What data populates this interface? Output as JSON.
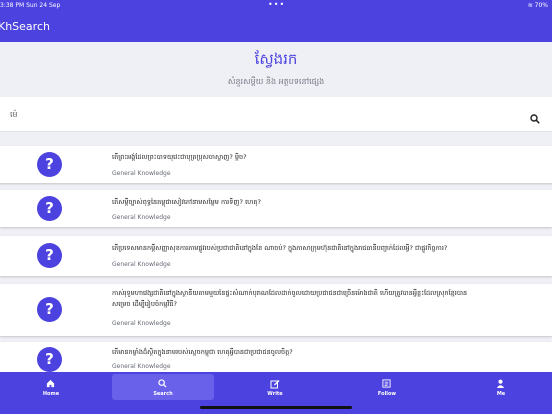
{
  "status_bar": {
    "time": "3:38 PM  Sun 24 Sep",
    "dots": "•••",
    "battery": "70%"
  },
  "app": {
    "title": "KhSearch"
  },
  "header": {
    "title": "ស្វែងរក",
    "subtitle": "សំនួរសម្ដីយ និង អត្ថបទនៅផ្សេង"
  },
  "search": {
    "value": "",
    "placeholder": "ម៉េ"
  },
  "results": [
    {
      "question": "តើព្រះអង្គ់ដែលព្រះបាទយុវេះជាបុត្រប្រុសចាស្ទាញ? ម្ដិច?",
      "category": "General Knowledge"
    },
    {
      "question": "តើសម្ដីច្បាស់ពុទ្ធនៃគម្ពុជាសៀវភៅនាមសម្ដែម ការទិញ? ហេតុ?",
      "category": "General Knowledge"
    },
    {
      "question": "តើប្រទេសមានកម្ដីសញ្ញាសុខការតាមផ្លូវរបស់ប្រជាជាតិនៅក្នុងខែ ណាចប់? ក្នុងភាសាក្រុមហ៊ុនជាតិនៅក្នុងរាជធានីបញ្ជាក់ដែលអ្វី? ជាផ្លូវកិច្ចការ?",
      "category": "General Knowledge"
    },
    {
      "question": "កាស់រុទូមហាវេង្សជាតិនៅក្នុងស្ថានីយតាមមួយនៃផ្ទះសំណាក់បុរាណដែលដាក់ចូលដោយប្រជាជនជាច្រើនម៉ោងជាតិ ហើយត្រូវបានអ្វីខ្លះដែលស្រុកខ្មែរបានសម្រេច ដើម្បីរៀបចំកម្មវិធី?",
      "category": "General Knowledge"
    },
    {
      "question": "តើមានកម្លាំងដ៏ស្ថិតក្នុងនាមរបស់ស្ដេចកម្ពុជា ហេតុអ្វីបានជាប្រជាជនចូលចិត្ត?",
      "category": "General Knowledge"
    }
  ],
  "tabs": [
    {
      "label": "Home",
      "icon": "home-icon",
      "active": false
    },
    {
      "label": "Search",
      "icon": "search-icon",
      "active": true
    },
    {
      "label": "Write",
      "icon": "write-icon",
      "active": false
    },
    {
      "label": "Follow",
      "icon": "follow-icon",
      "active": false
    },
    {
      "label": "Me",
      "icon": "person-icon",
      "active": false
    }
  ],
  "colors": {
    "accent": "#4c42e0",
    "background": "#eff0f5"
  }
}
